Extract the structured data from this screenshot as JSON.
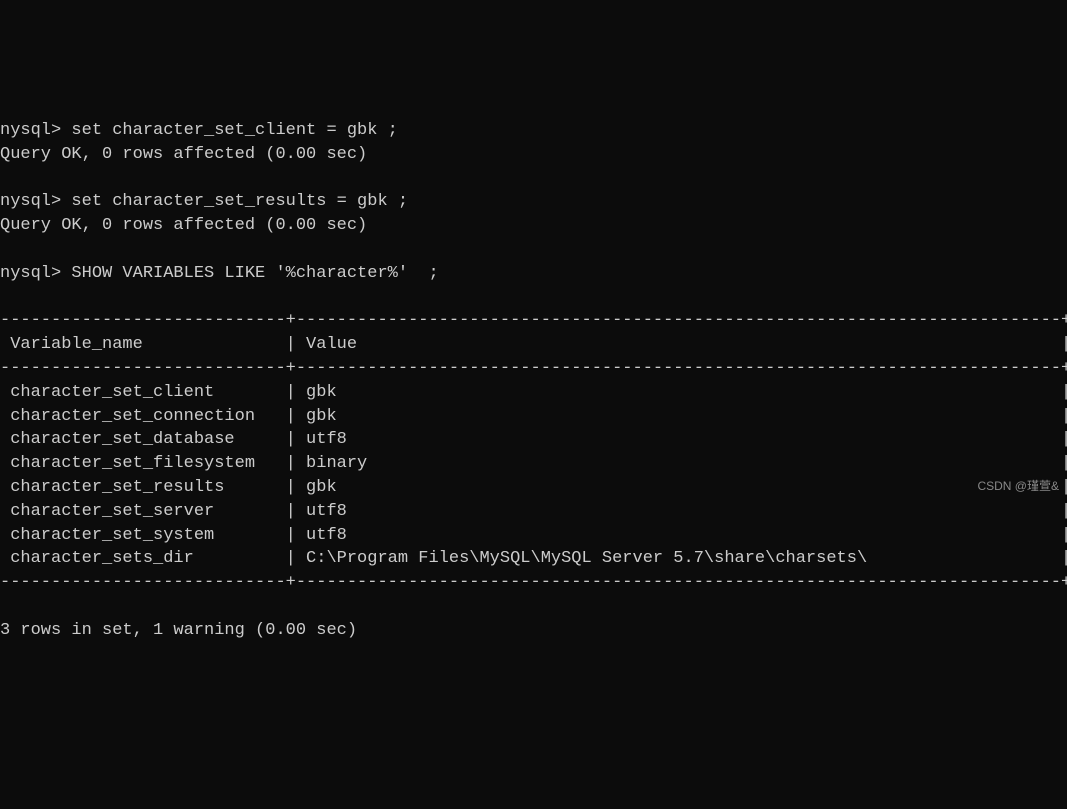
{
  "commands": [
    {
      "prompt": "nysql>",
      "cmd": "set character_set_client = gbk ;"
    },
    {
      "result": "Query OK, 0 rows affected (0.00 sec)"
    },
    {
      "blank": true
    },
    {
      "prompt": "nysql>",
      "cmd": "set character_set_results = gbk ;"
    },
    {
      "result": "Query OK, 0 rows affected (0.00 sec)"
    },
    {
      "blank": true
    },
    {
      "prompt": "nysql>",
      "cmd": "SHOW VARIABLES LIKE '%character%'  ;"
    }
  ],
  "table": {
    "headers": [
      "Variable_name",
      "Value"
    ],
    "rows": [
      [
        "character_set_client",
        "gbk"
      ],
      [
        "character_set_connection",
        "gbk"
      ],
      [
        "character_set_database",
        "utf8"
      ],
      [
        "character_set_filesystem",
        "binary"
      ],
      [
        "character_set_results",
        "gbk"
      ],
      [
        "character_set_server",
        "utf8"
      ],
      [
        "character_set_system",
        "utf8"
      ],
      [
        "character_sets_dir",
        "C:\\Program Files\\MySQL\\MySQL Server 5.7\\share\\charsets\\"
      ]
    ],
    "col1_width": 26,
    "col2_width": 73
  },
  "footer": "3 rows in set, 1 warning (0.00 sec)",
  "watermark": "CSDN @瑾萱&"
}
